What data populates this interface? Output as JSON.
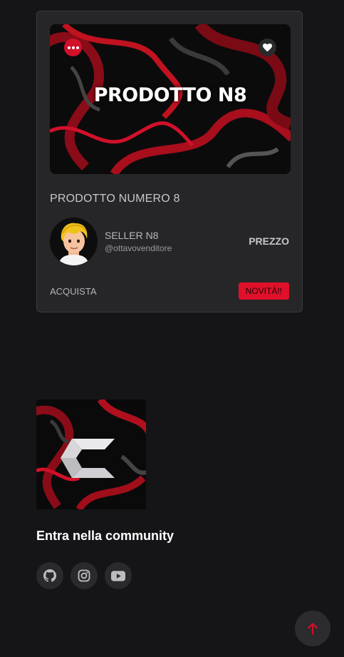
{
  "card": {
    "image_text": "PRODOTTO N8",
    "more_icon": "more-horizontal-icon",
    "like_icon": "heart-icon",
    "title": "PRODOTTO NUMERO 8",
    "seller": {
      "name": "SELLER N8",
      "handle": "@ottavovenditore"
    },
    "price": "PREZZO",
    "buy_label": "ACQUISTA",
    "badge": "NOVITÀ!!"
  },
  "footer": {
    "community_title": "Entra nella community",
    "socials": [
      {
        "icon": "github-icon"
      },
      {
        "icon": "instagram-icon"
      },
      {
        "icon": "youtube-icon"
      }
    ]
  },
  "back_to_top_icon": "arrow-up-icon",
  "colors": {
    "accent": "#d2102a",
    "background": "#151517",
    "card": "#262628"
  }
}
